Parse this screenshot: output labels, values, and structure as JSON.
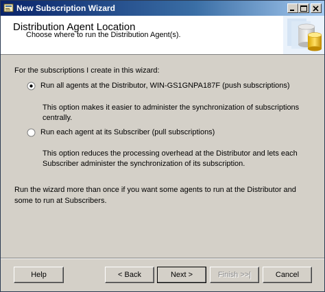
{
  "window": {
    "title": "New Subscription Wizard"
  },
  "header": {
    "title": "Distribution Agent Location",
    "subtitle": "Choose where to run the Distribution Agent(s)."
  },
  "body": {
    "intro": "For the subscriptions I create in this wizard:",
    "options": [
      {
        "label": "Run all agents at the Distributor, WIN-GS1GNPA187F (push subscriptions)",
        "description": "This option makes it easier to administer the synchronization of subscriptions centrally.",
        "selected": true
      },
      {
        "label": "Run each agent at its Subscriber (pull subscriptions)",
        "description": "This option reduces the processing overhead at the Distributor and lets each Subscriber administer the synchronization of its subscription.",
        "selected": false
      }
    ],
    "note": "Run the wizard more than once if you want some agents to run at the Distributor and some to run at Subscribers."
  },
  "buttons": {
    "help": "Help",
    "back": "< Back",
    "next": "Next >",
    "finish": "Finish >>|",
    "cancel": "Cancel"
  },
  "icons": {
    "title": "wizard-icon",
    "header_art": "database-subscription-art"
  }
}
